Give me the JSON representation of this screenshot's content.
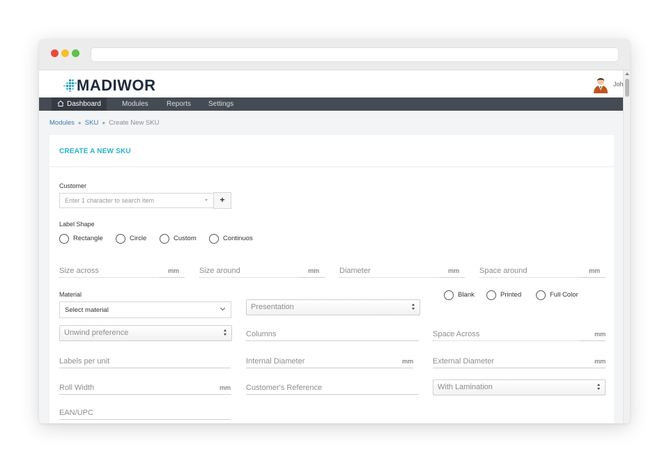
{
  "brand": {
    "name": "MADIWOR",
    "logo_icon": "madiwor-logo-mark"
  },
  "user": {
    "name": "John McClane",
    "avatar_icon": "user-avatar-icon"
  },
  "nav": {
    "items": [
      {
        "label": "Dashboard",
        "icon": "home-icon",
        "active": true
      },
      {
        "label": "Modules"
      },
      {
        "label": "Reports"
      },
      {
        "label": "Settings"
      }
    ]
  },
  "breadcrumb": [
    "Modules",
    "SKU",
    "Create New SKU"
  ],
  "form": {
    "title": "CREATE A NEW SKU",
    "customer": {
      "label": "Customer",
      "placeholder": "Enter 1 character to search item",
      "add_label": "+"
    },
    "label_shape": {
      "label": "Label Shape",
      "options": [
        "Rectangle",
        "Circle",
        "Custom",
        "Continuos"
      ]
    },
    "size_across": {
      "placeholder": "Size across",
      "unit": "mm"
    },
    "size_around": {
      "placeholder": "Size around",
      "unit": "mm"
    },
    "diameter": {
      "placeholder": "Diameter",
      "unit": "mm"
    },
    "space_around": {
      "placeholder": "Space around",
      "unit": "mm"
    },
    "material": {
      "label": "Material",
      "value": "Select material"
    },
    "presentation": {
      "placeholder": "Presentation"
    },
    "print_type": {
      "options": [
        "Blank",
        "Printed",
        "Full Color"
      ]
    },
    "unwind": {
      "placeholder": "Unwind preference"
    },
    "columns": {
      "placeholder": "Columns"
    },
    "space_across": {
      "placeholder": "Space Across",
      "unit": "mm"
    },
    "labels_per_unit": {
      "placeholder": "Labels per unit"
    },
    "internal_diameter": {
      "placeholder": "Internal Diameter",
      "unit": "mm"
    },
    "external_diameter": {
      "placeholder": "External Diameter",
      "unit": "mm"
    },
    "roll_width": {
      "placeholder": "Roll Width",
      "unit": "mm"
    },
    "customer_reference": {
      "placeholder": "Customer's Reference"
    },
    "lamination": {
      "value": "With Lamination"
    },
    "ean": {
      "placeholder": "EAN/UPC"
    }
  },
  "colors": {
    "accent": "#25b3c9",
    "nav_bg": "#454b54",
    "link": "#3a78b8"
  }
}
